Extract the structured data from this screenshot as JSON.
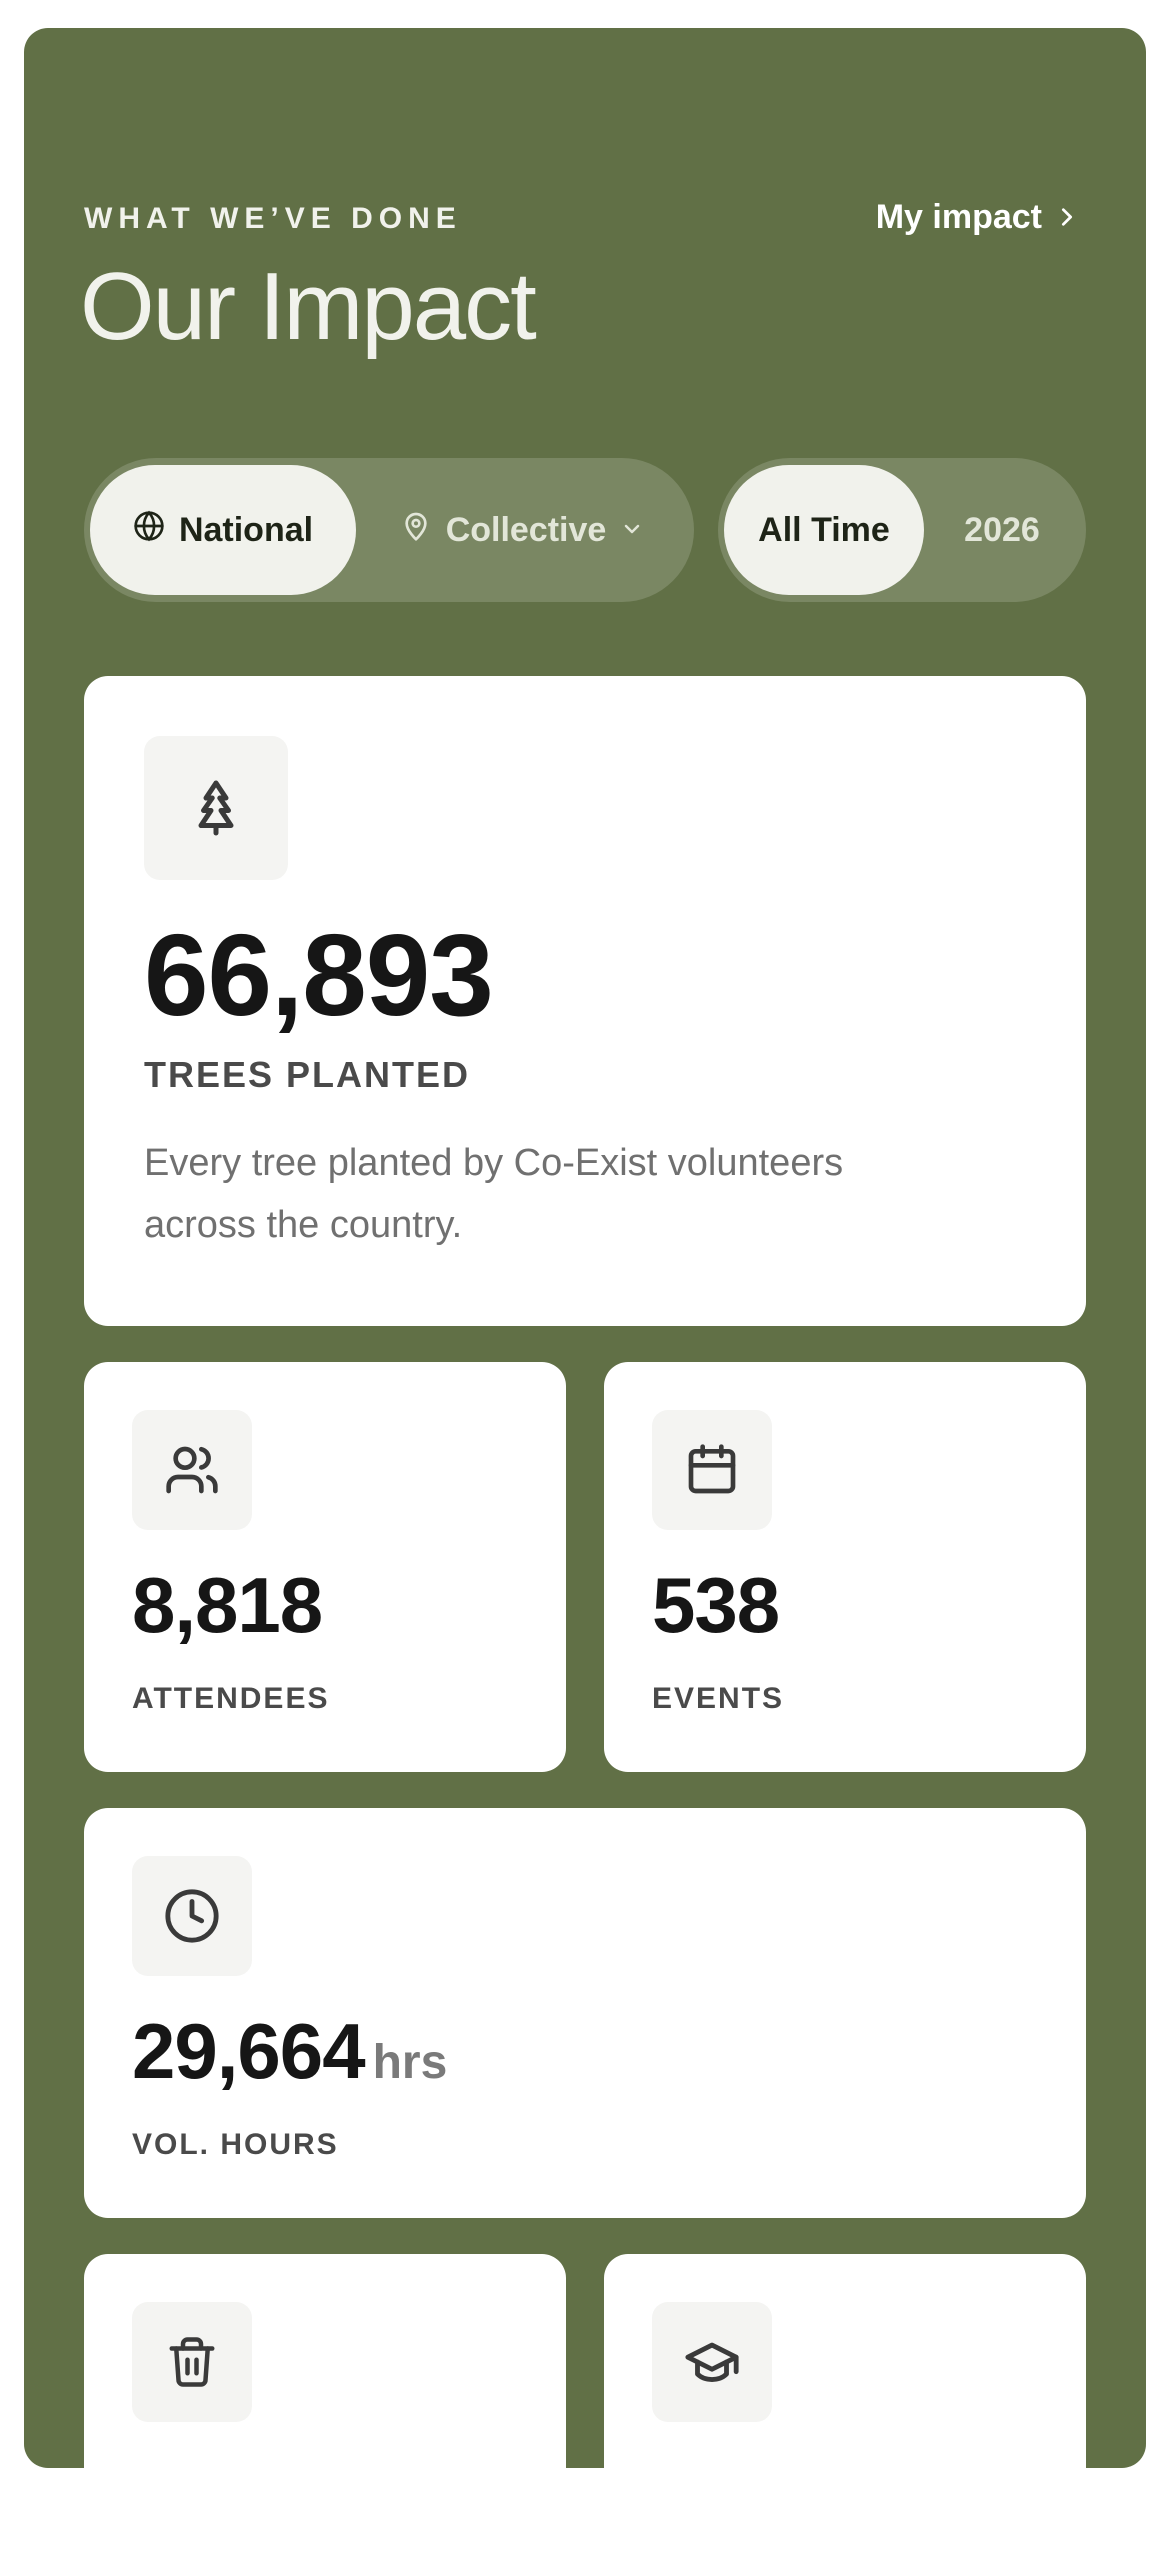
{
  "header": {
    "eyebrow": "WHAT WE’VE DONE",
    "title": "Our Impact",
    "my_impact_label": "My impact"
  },
  "filters": {
    "scope": {
      "selected": "National",
      "other": "Collective"
    },
    "time": {
      "selected": "All Time",
      "other": "2026"
    }
  },
  "stats": {
    "trees": {
      "icon": "tree-icon",
      "value": "66,893",
      "label": "TREES PLANTED",
      "description": "Every tree planted by Co-Exist volunteers across the country."
    },
    "attendees": {
      "icon": "users-icon",
      "value": "8,818",
      "label": "ATTENDEES"
    },
    "events": {
      "icon": "calendar-icon",
      "value": "538",
      "label": "EVENTS"
    },
    "hours": {
      "icon": "clock-icon",
      "value": "29,664",
      "unit": "hrs",
      "label": "VOL. HOURS"
    },
    "rubbish": {
      "icon": "trash-icon"
    },
    "education": {
      "icon": "graduation-cap-icon"
    }
  },
  "colors": {
    "panel": "#617046",
    "card": "#ffffff",
    "active_pill": "#f1f2ec"
  }
}
